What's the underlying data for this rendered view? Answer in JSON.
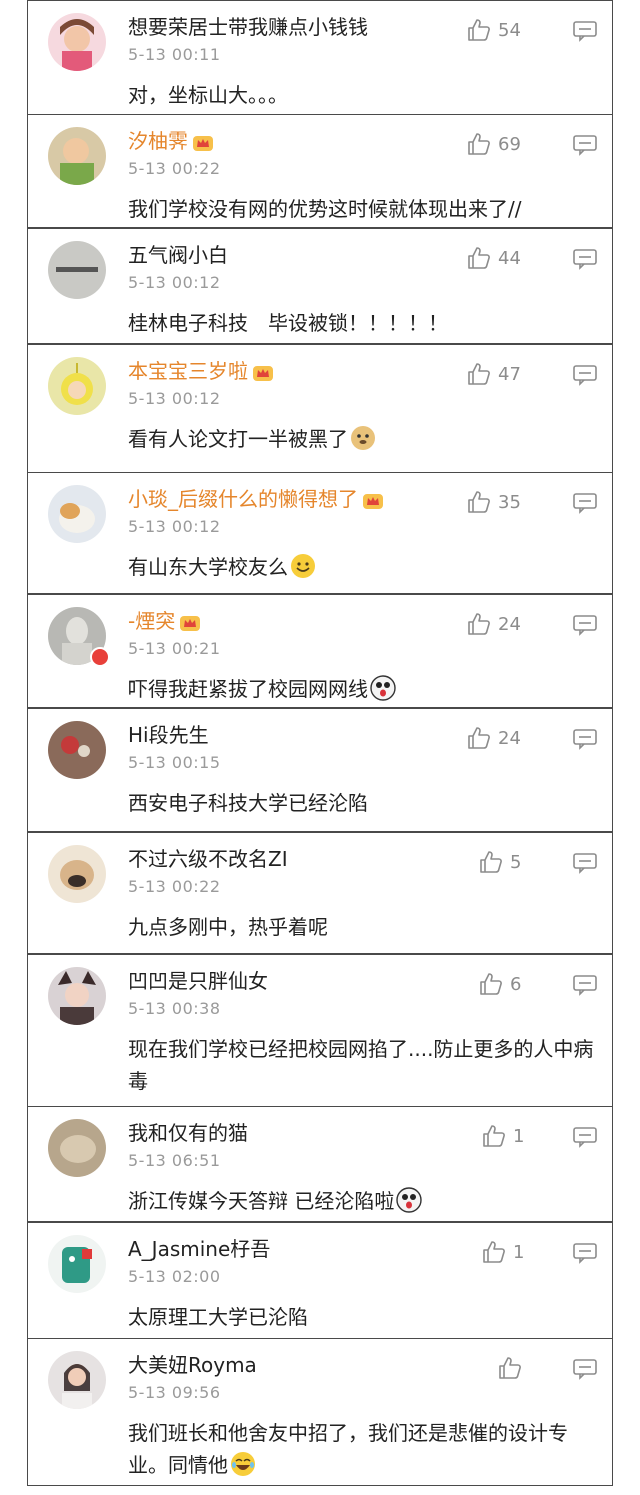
{
  "colors": {
    "vip_name": "#e5862c",
    "time": "#9a9a9a",
    "icon": "#8c8c8c",
    "border": "#4a4a4a"
  },
  "comments": [
    {
      "name": "想要荣居士带我赚点小钱钱",
      "time": "5-13 00:11",
      "text": "对，坐标山大。。。",
      "likes": "54",
      "vip": false,
      "avatar": "pink-cartoon-avatar"
    },
    {
      "name": "汐柚霁",
      "time": "5-13 00:22",
      "text": "我们学校没有网的优势这时候就体现出来了//",
      "likes": "69",
      "vip": true,
      "avatar": "baby-photo-avatar"
    },
    {
      "name": "五气阀小白",
      "time": "5-13 00:12",
      "text": "桂林电子科技　毕设被锁！！！！！",
      "likes": "44",
      "vip": false,
      "avatar": "gray-text-avatar"
    },
    {
      "name": "本宝宝三岁啦",
      "time": "5-13 00:12",
      "text": "看有人论文打一半被黑了",
      "likes": "47",
      "vip": true,
      "avatar": "teletubby-avatar",
      "emoji": "doge-emoji"
    },
    {
      "name": "小琰_后缀什么的懒得想了",
      "time": "5-13 00:12",
      "text": "有山东大学校友么",
      "likes": "35",
      "vip": true,
      "avatar": "cat-photo-avatar",
      "emoji": "smile-emoji"
    },
    {
      "name": "-煙突",
      "time": "5-13 00:21",
      "text": "吓得我赶紧拔了校园网网线",
      "likes": "24",
      "vip": true,
      "avatar": "statue-avatar",
      "emoji": "shocked-emoji"
    },
    {
      "name": "Hi段先生",
      "time": "5-13 00:15",
      "text": "西安电子科技大学已经沦陷",
      "likes": "24",
      "vip": false,
      "avatar": "flower-photo-avatar"
    },
    {
      "name": "不过六级不改名ZI",
      "time": "5-13 00:22",
      "text": "九点多刚中，热乎着呢",
      "likes": "5",
      "vip": false,
      "avatar": "pug-avatar"
    },
    {
      "name": "凹凹是只胖仙女",
      "time": "5-13 00:38",
      "text": "现在我们学校已经把校园网掐了....防止更多的人中病毒",
      "likes": "6",
      "vip": false,
      "avatar": "girl-cat-ears-avatar"
    },
    {
      "name": "我和仅有的猫",
      "time": "5-13 06:51",
      "text": "浙江传媒今天答辩 已经沦陷啦",
      "likes": "1",
      "vip": false,
      "avatar": "blurry-photo-avatar",
      "emoji": "shocked-emoji"
    },
    {
      "name": "A_Jasmine杍吾",
      "time": "5-13 02:00",
      "text": "太原理工大学已沦陷",
      "likes": "1",
      "vip": false,
      "avatar": "green-cartoon-avatar"
    },
    {
      "name": "大美妞Royma",
      "time": "5-13 09:56",
      "text": "我们班长和他舍友中招了，我们还是悲催的设计专业。同情他",
      "likes": "",
      "vip": false,
      "avatar": "woman-photo-avatar",
      "emoji": "laugh-cry-emoji"
    }
  ]
}
